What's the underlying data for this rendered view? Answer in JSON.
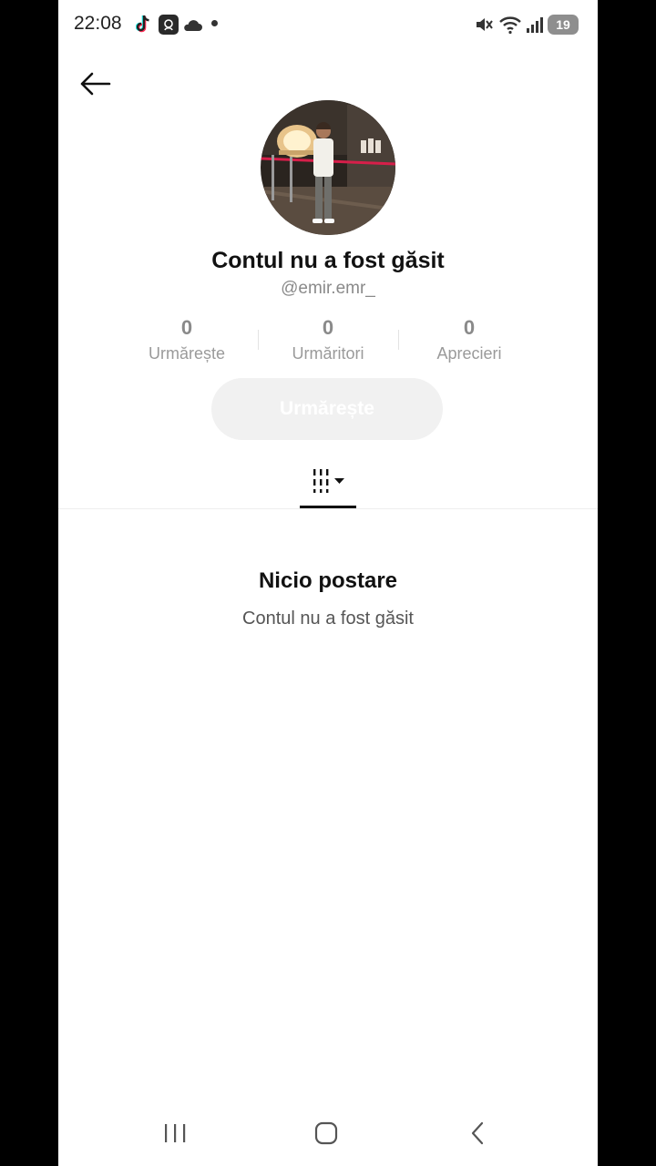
{
  "status_bar": {
    "time": "22:08",
    "battery": "19",
    "icons": [
      "tiktok-icon",
      "app-icon",
      "cloud-icon",
      "notification-dot-icon",
      "mute-icon",
      "wifi-icon",
      "signal-icon",
      "battery-icon"
    ]
  },
  "header": {
    "back_icon": "arrow-left-icon"
  },
  "profile": {
    "title": "Contul nu a fost găsit",
    "handle": "@emir.emr_"
  },
  "stats": [
    {
      "value": "0",
      "label": "Urmărește"
    },
    {
      "value": "0",
      "label": "Urmăritori"
    },
    {
      "value": "0",
      "label": "Aprecieri"
    }
  ],
  "follow_button": {
    "label": "Urmărește"
  },
  "tabs": {
    "active_icon": "grid-dropdown-icon"
  },
  "empty_state": {
    "title": "Nicio postare",
    "subtitle": "Contul nu a fost găsit"
  },
  "colors": {
    "accent_text": "#111111",
    "muted": "#8a8a8a",
    "button_disabled_bg": "#f1f1f1"
  },
  "navigation_bar": [
    "recent-apps-icon",
    "home-icon",
    "back-icon"
  ]
}
